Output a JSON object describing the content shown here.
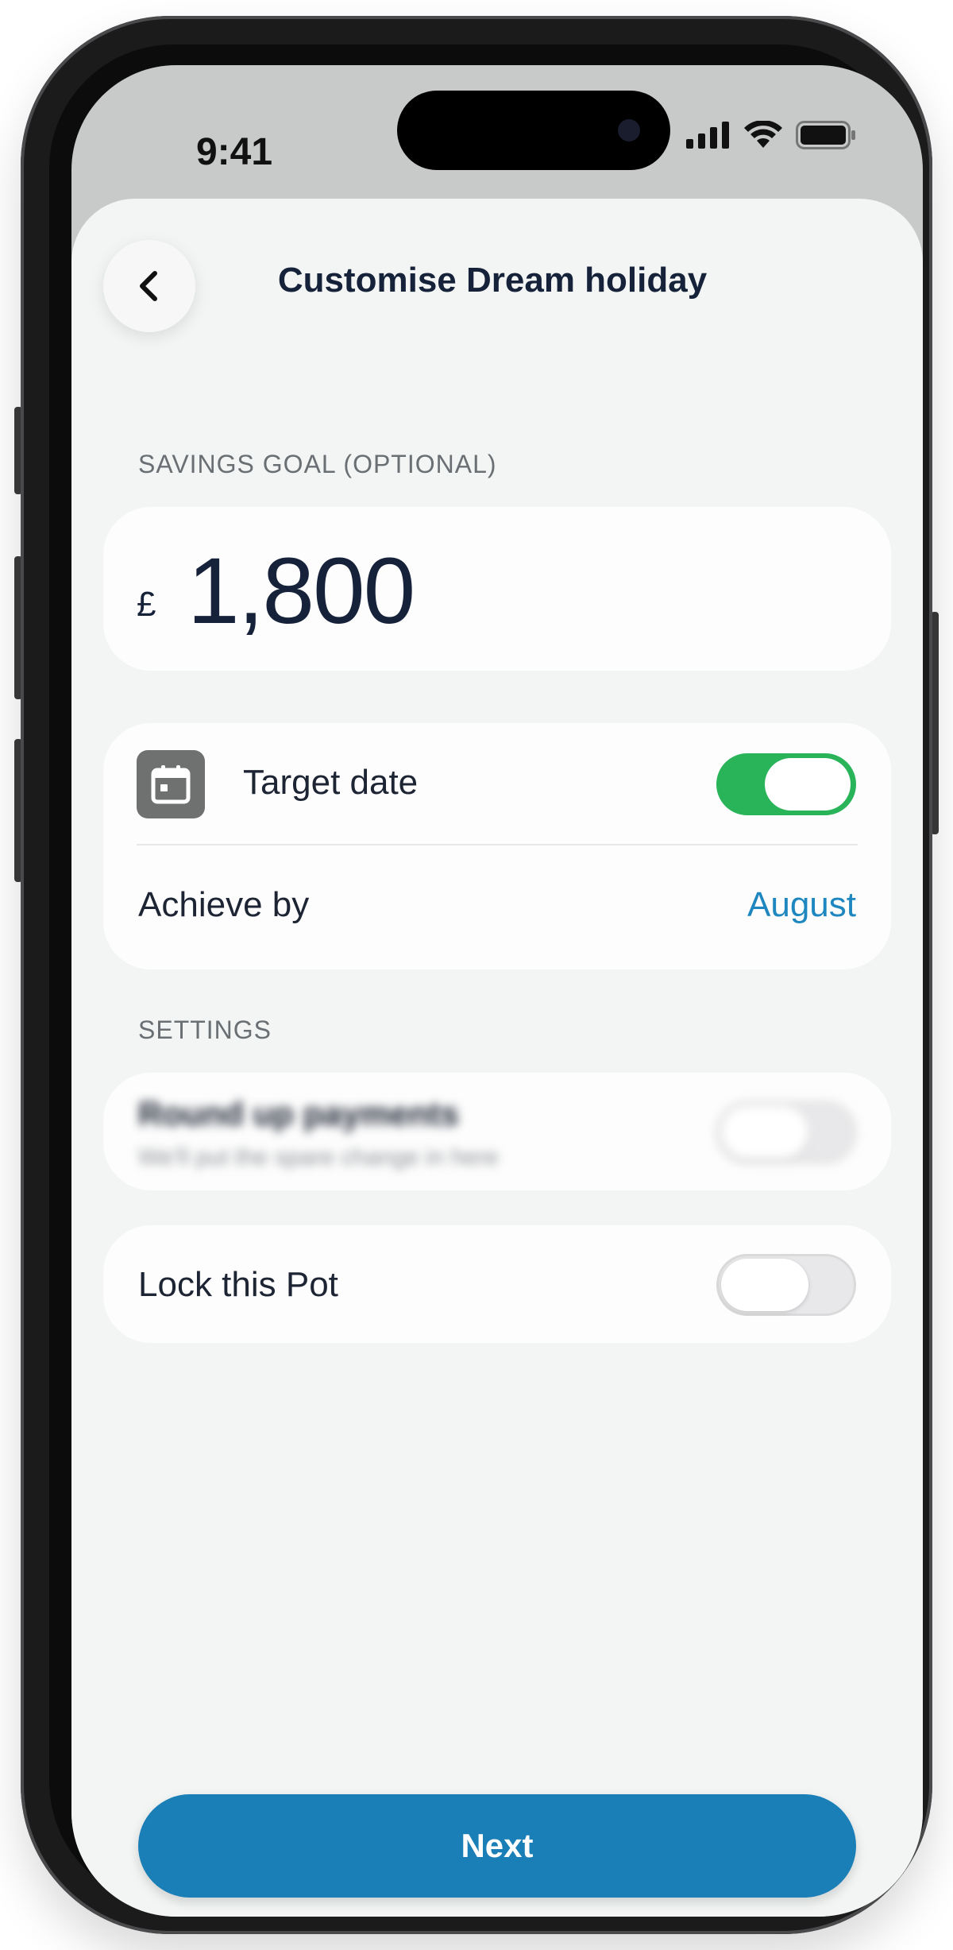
{
  "status_bar": {
    "time": "9:41"
  },
  "header": {
    "title": "Customise Dream holiday",
    "back_icon": "chevron-left-icon"
  },
  "savings_goal": {
    "section_label": "SAVINGS GOAL (OPTIONAL)",
    "currency": "£",
    "amount": "1,800"
  },
  "target_date": {
    "label": "Target date",
    "icon": "calendar-icon",
    "toggle_on": true,
    "achieve_label": "Achieve by",
    "achieve_value": "August"
  },
  "settings": {
    "section_label": "SETTINGS",
    "round_up": {
      "title": "Round up payments",
      "subtitle": "We'll put the spare change in here",
      "toggle_on": false
    },
    "lock": {
      "label": "Lock this Pot",
      "toggle_on": false
    }
  },
  "footer": {
    "next_label": "Next"
  },
  "colors": {
    "accent": "#1a7fb7",
    "toggle_on": "#2ab45a",
    "link": "#1f87c0"
  }
}
